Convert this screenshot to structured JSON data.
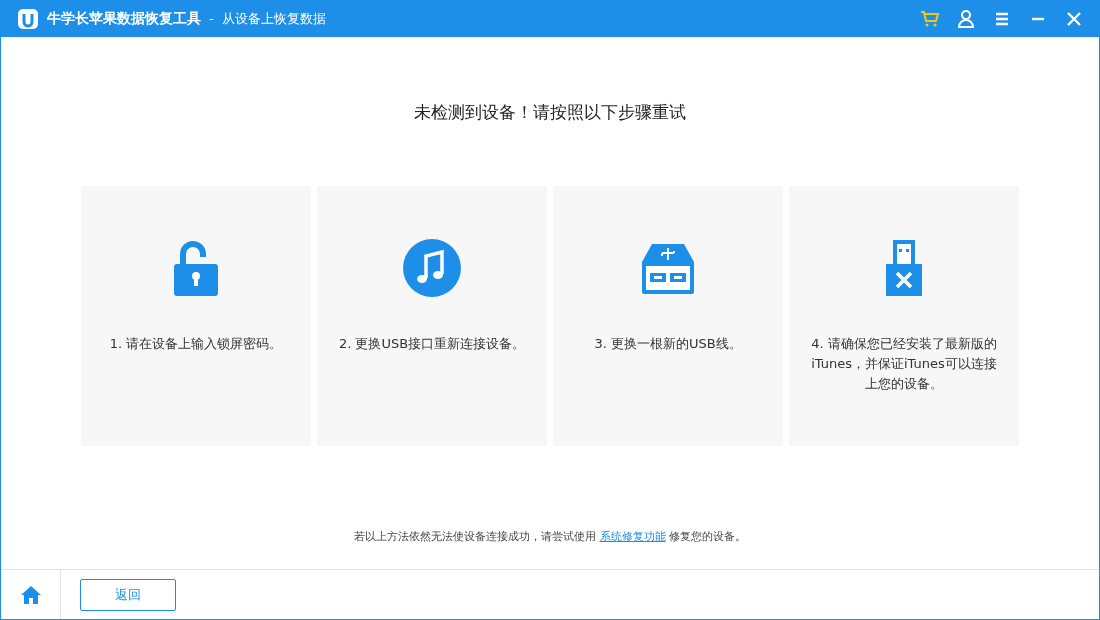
{
  "window": {
    "app_name": "牛学长苹果数据恢复工具",
    "separator": "-",
    "subtitle": "从设备上恢复数据"
  },
  "heading": "未检测到设备！请按照以下步骤重试",
  "steps": [
    {
      "kind": "lock",
      "text": "1. 请在设备上输入锁屏密码。"
    },
    {
      "kind": "music",
      "text": "2. 更换USB接口重新连接设备。"
    },
    {
      "kind": "hub",
      "text": "3. 更换一根新的USB线。"
    },
    {
      "kind": "usb",
      "text": "4. 请确保您已经安装了最新版的iTunes，并保证iTunes可以连接上您的设备。"
    }
  ],
  "note": {
    "before": "若以上方法依然无法使设备连接成功，请尝试使用",
    "link": "系统修复功能",
    "after": "修复您的设备。"
  },
  "back_button": "返回"
}
